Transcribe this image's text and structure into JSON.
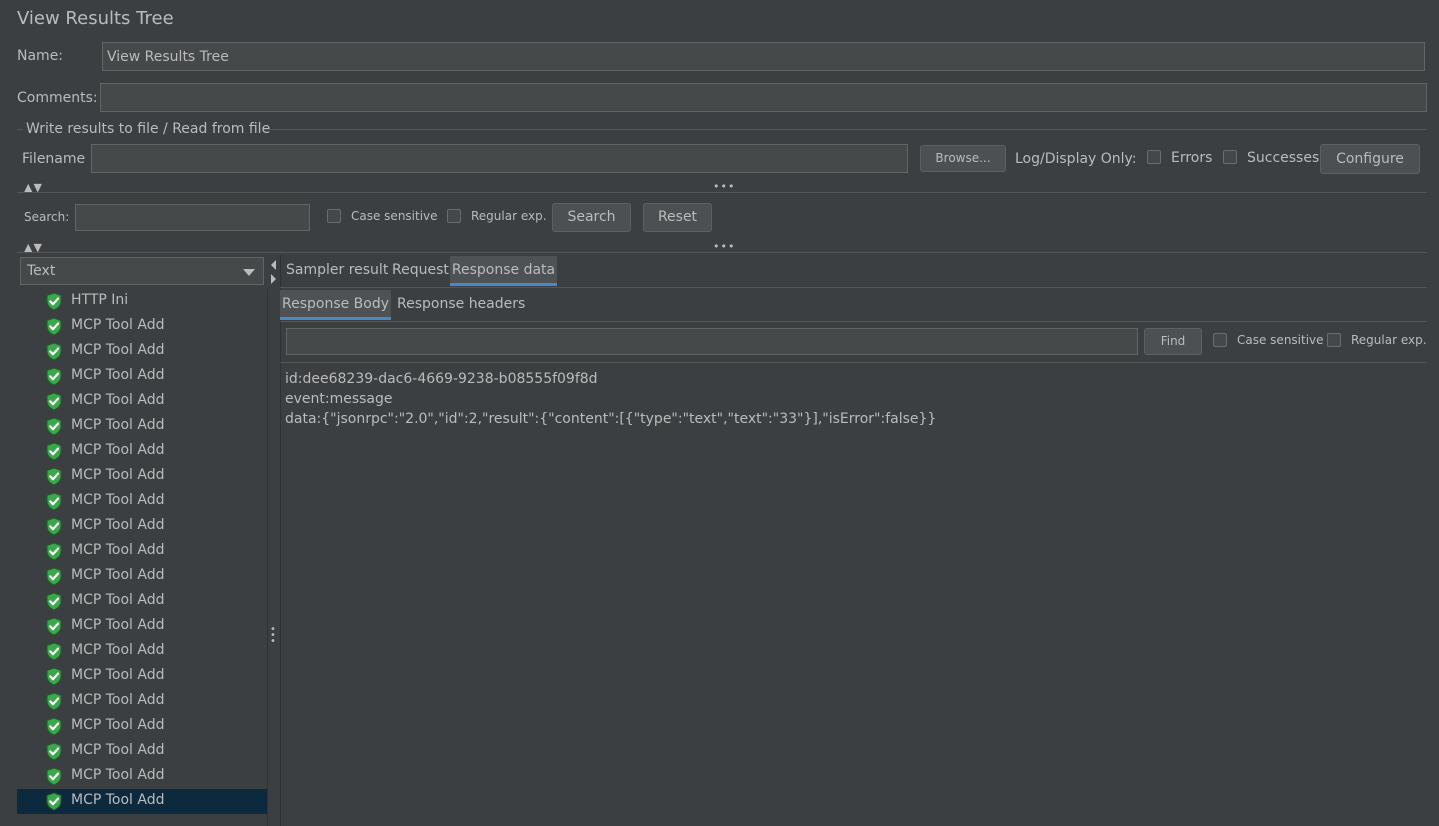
{
  "window": {
    "title": "View Results Tree"
  },
  "form": {
    "name_label": "Name:",
    "name_value": "View Results Tree",
    "comments_label": "Comments:",
    "comments_value": ""
  },
  "file_group": {
    "legend": "Write results to file / Read from file",
    "filename_label": "Filename",
    "filename_value": "",
    "browse_label": "Browse...",
    "log_display_label": "Log/Display Only:",
    "errors_label": "Errors",
    "successes_label": "Successes",
    "configure_label": "Configure"
  },
  "search": {
    "label": "Search:",
    "value": "",
    "case_sensitive_label": "Case sensitive",
    "regular_exp_label": "Regular exp.",
    "search_button": "Search",
    "reset_button": "Reset"
  },
  "renderer": {
    "selected": "Text"
  },
  "tree": {
    "items": [
      {
        "label": "HTTP Ini"
      },
      {
        "label": "MCP Tool Add"
      },
      {
        "label": "MCP Tool Add"
      },
      {
        "label": "MCP Tool Add"
      },
      {
        "label": "MCP Tool Add"
      },
      {
        "label": "MCP Tool Add"
      },
      {
        "label": "MCP Tool Add"
      },
      {
        "label": "MCP Tool Add"
      },
      {
        "label": "MCP Tool Add"
      },
      {
        "label": "MCP Tool Add"
      },
      {
        "label": "MCP Tool Add"
      },
      {
        "label": "MCP Tool Add"
      },
      {
        "label": "MCP Tool Add"
      },
      {
        "label": "MCP Tool Add"
      },
      {
        "label": "MCP Tool Add"
      },
      {
        "label": "MCP Tool Add"
      },
      {
        "label": "MCP Tool Add"
      },
      {
        "label": "MCP Tool Add"
      },
      {
        "label": "MCP Tool Add"
      },
      {
        "label": "MCP Tool Add"
      },
      {
        "label": "MCP Tool Add"
      }
    ],
    "selected_index": 20,
    "status_icon": "success-shield-check-icon"
  },
  "tabs": {
    "main": [
      "Sampler result",
      "Request",
      "Response data"
    ],
    "main_active": "Response data",
    "sub": [
      "Response Body",
      "Response headers"
    ],
    "sub_active": "Response Body"
  },
  "find": {
    "value": "",
    "find_button": "Find",
    "case_sensitive_label": "Case sensitive",
    "regular_exp_label": "Regular exp."
  },
  "response": {
    "lines": [
      "id:dee68239-dac6-4669-9238-b08555f09f8d",
      "event:message",
      "data:{\"jsonrpc\":\"2.0\",\"id\":2,\"result\":{\"content\":[{\"type\":\"text\",\"text\":\"33\"}],\"isError\":false}}"
    ]
  },
  "colors": {
    "background": "#3c3f41",
    "field": "#45494a",
    "selection": "#0d293e",
    "tab_accent": "#4a88c7",
    "success_green": "#3aa84a"
  }
}
